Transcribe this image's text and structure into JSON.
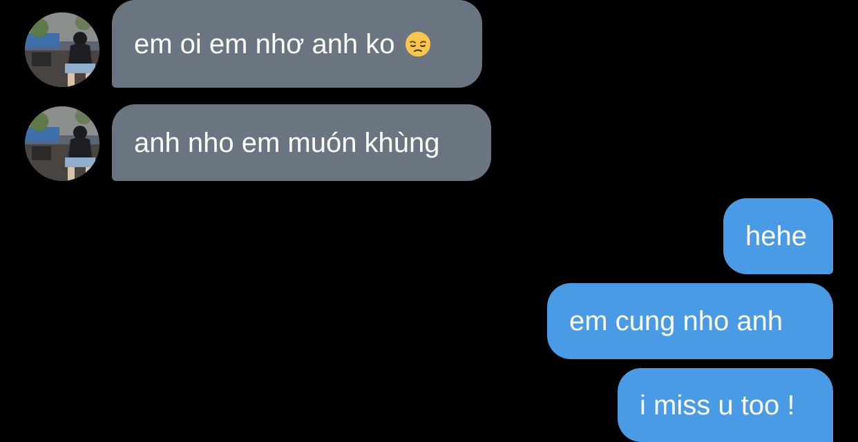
{
  "conversation": {
    "messages": [
      {
        "direction": "incoming",
        "text": "em oi em nhơ anh ko",
        "emoji": "pensive-face-emoji"
      },
      {
        "direction": "incoming",
        "text": "anh nho em muón khùng"
      },
      {
        "direction": "outgoing",
        "text": "hehe"
      },
      {
        "direction": "outgoing",
        "text": "em cung nho anh"
      },
      {
        "direction": "outgoing",
        "text": "i miss u too !"
      }
    ]
  },
  "colors": {
    "background": "#000000",
    "incoming_bubble": "#6a7581",
    "outgoing_bubble": "#4a9be6",
    "text": "#ffffff"
  },
  "icons": {
    "avatar": "contact-photo-avatar",
    "emoji": "pensive-face-emoji"
  }
}
